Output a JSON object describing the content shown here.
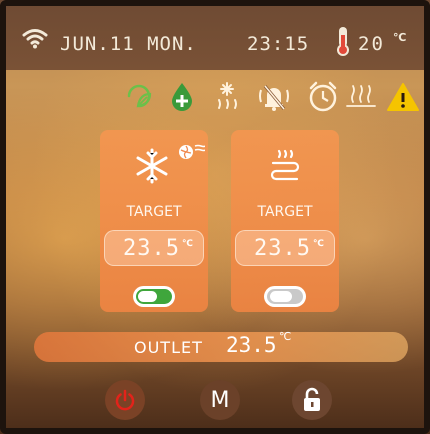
{
  "status_bar": {
    "date": "JUN.11 MON.",
    "time": "23:15",
    "temperature": "20",
    "temperature_unit": "℃"
  },
  "icons_row": [
    "eco-leaf-icon",
    "add-water-icon",
    "defrost-icon",
    "mute-icon",
    "alarm-clock-icon",
    "floor-heating-icon",
    "warning-icon"
  ],
  "cooling_card": {
    "target_label": "TARGET",
    "value": "23.5",
    "unit": "℃",
    "enabled": true
  },
  "heating_card": {
    "target_label": "TARGET",
    "value": "23.5",
    "unit": "℃",
    "enabled": false
  },
  "outlet": {
    "label": "OUTLET",
    "value": "23.5",
    "unit": "℃"
  },
  "buttons": {
    "mode_label": "M"
  },
  "colors": {
    "accent_orange": "#f29a55",
    "toggle_on": "#3fa63c",
    "toggle_off": "#c9c9c9",
    "eco_green": "#6cc04a",
    "warning_yellow": "#f5c400",
    "power_red": "#e2231a"
  }
}
